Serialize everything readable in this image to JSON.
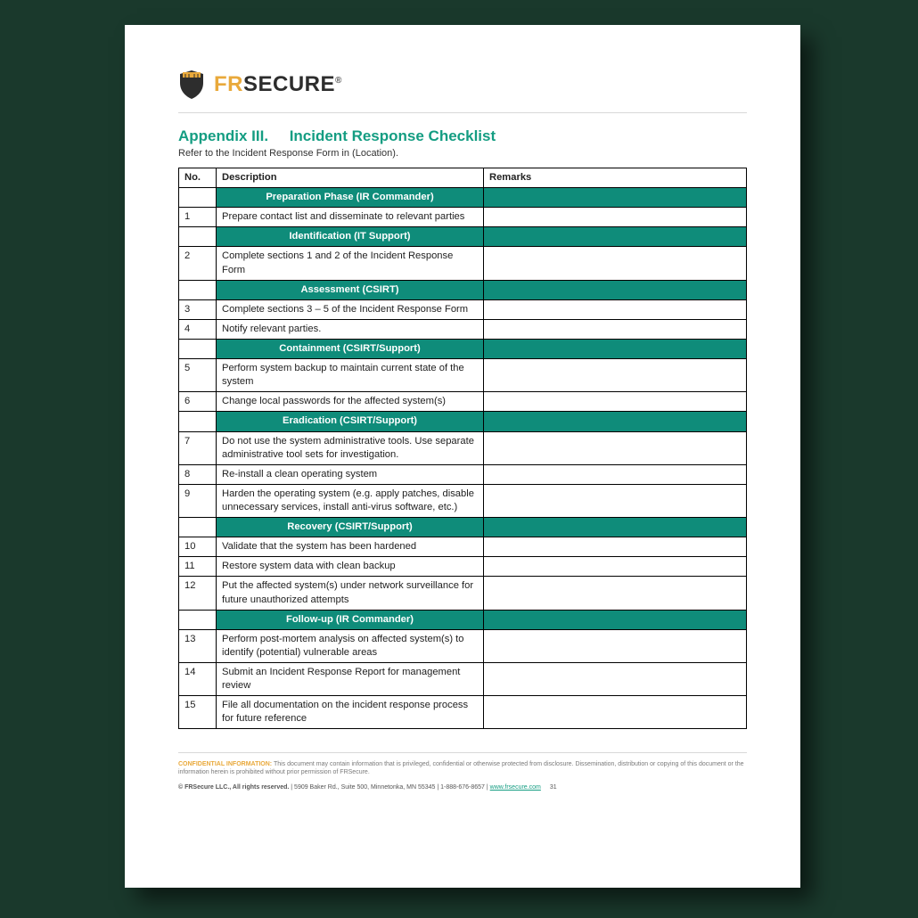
{
  "logo": {
    "fr": "FR",
    "sec": "SECURE",
    "reg": "®"
  },
  "heading": {
    "appendix": "Appendix III.",
    "title": "Incident Response Checklist"
  },
  "subtitle": "Refer to the Incident Response Form in (Location).",
  "columns": {
    "no": "No.",
    "desc": "Description",
    "rem": "Remarks"
  },
  "sections": [
    {
      "label": "Preparation Phase (IR Commander)",
      "rows": [
        {
          "no": "1",
          "desc": "Prepare contact list and disseminate to relevant parties",
          "rem": ""
        }
      ]
    },
    {
      "label": "Identification (IT Support)",
      "rows": [
        {
          "no": "2",
          "desc": "Complete sections 1 and 2 of the Incident Response Form",
          "rem": ""
        }
      ]
    },
    {
      "label": "Assessment (CSIRT)",
      "rows": [
        {
          "no": "3",
          "desc": "Complete sections 3 – 5 of the Incident Response Form",
          "rem": ""
        },
        {
          "no": "4",
          "desc": "Notify relevant parties.",
          "rem": ""
        }
      ]
    },
    {
      "label": "Containment (CSIRT/Support)",
      "rows": [
        {
          "no": "5",
          "desc": "Perform system backup to maintain current state of the system",
          "rem": ""
        },
        {
          "no": "6",
          "desc": "Change local passwords for the affected system(s)",
          "rem": ""
        }
      ]
    },
    {
      "label": "Eradication (CSIRT/Support)",
      "rows": [
        {
          "no": "7",
          "desc": "Do not use the system administrative tools. Use separate administrative tool sets for investigation.",
          "rem": ""
        },
        {
          "no": "8",
          "desc": "Re-install a clean operating system",
          "rem": ""
        },
        {
          "no": "9",
          "desc": "Harden the operating system (e.g. apply patches, disable unnecessary services, install anti-virus software, etc.)",
          "rem": ""
        }
      ]
    },
    {
      "label": "Recovery (CSIRT/Support)",
      "rows": [
        {
          "no": "10",
          "desc": "Validate that the system has been hardened",
          "rem": ""
        },
        {
          "no": "11",
          "desc": "Restore system data with clean backup",
          "rem": ""
        },
        {
          "no": "12",
          "desc": "Put the affected system(s) under network surveillance for future unauthorized attempts",
          "rem": ""
        }
      ]
    },
    {
      "label": "Follow-up (IR Commander)",
      "rows": [
        {
          "no": "13",
          "desc": "Perform post-mortem analysis on affected system(s) to identify (potential) vulnerable areas",
          "rem": ""
        },
        {
          "no": "14",
          "desc": "Submit an Incident Response Report for management review",
          "rem": ""
        },
        {
          "no": "15",
          "desc": "File all documentation on the incident response process for future reference",
          "rem": ""
        }
      ]
    }
  ],
  "disclaimer": {
    "label": "CONFIDENTIAL INFORMATION:",
    "text": "This document may contain information that is privileged, confidential or otherwise protected from disclosure. Dissemination, distribution or copying of this document or the information herein is prohibited without prior permission of FRSecure."
  },
  "footer": {
    "copyright": "© FRSecure LLC., All rights reserved.",
    "address": "| 5909 Baker Rd., Suite 500, Minnetonka, MN 55345 | 1-888-676-8657 |",
    "link": "www.frsecure.com",
    "page": "31"
  }
}
